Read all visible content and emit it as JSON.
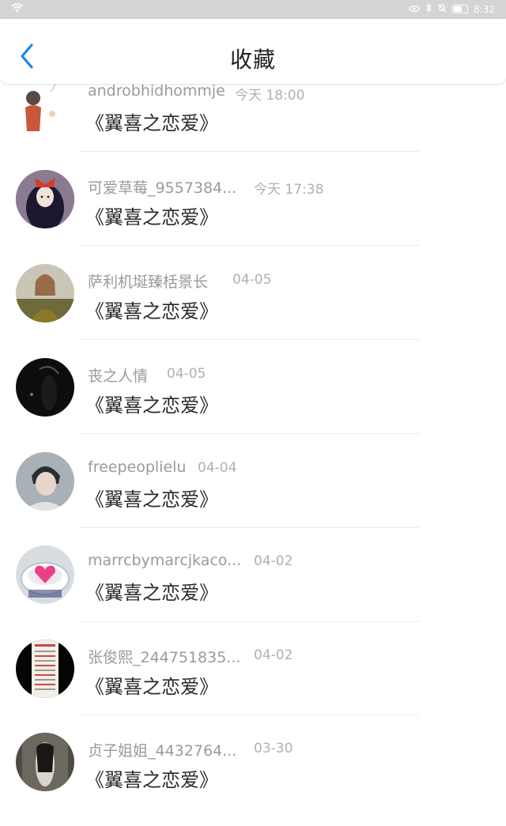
{
  "status_bar": {
    "time": "8:32"
  },
  "header": {
    "title": "收藏"
  },
  "items": [
    {
      "name": "androbhidhommje",
      "time": "今天 18:00",
      "book": "《翼喜之恋爱》"
    },
    {
      "name": "可爱草莓_9557384...",
      "time": "今天 17:38",
      "book": "《翼喜之恋爱》"
    },
    {
      "name": "萨利机埏臻栝景长",
      "time": "04-05",
      "book": "《翼喜之恋爱》"
    },
    {
      "name": "丧之人情",
      "time": "04-05",
      "book": "《翼喜之恋爱》"
    },
    {
      "name": "freepeoplielu",
      "time": "04-04",
      "book": "《翼喜之恋爱》"
    },
    {
      "name": "marrcbymarcjkaco...",
      "time": "04-02",
      "book": "《翼喜之恋爱》"
    },
    {
      "name": "张俊熙_244751835...",
      "time": "04-02",
      "book": "《翼喜之恋爱》"
    },
    {
      "name": "贞子姐姐_4432764...",
      "time": "03-30",
      "book": "《翼喜之恋爱》"
    }
  ],
  "icons": {
    "back": "chevron-left-icon",
    "wifi": "wifi-icon",
    "eye": "eye-comfort-icon",
    "bluetooth": "bluetooth-icon",
    "mute": "bell-off-icon",
    "battery": "battery-icon"
  },
  "colors": {
    "accent": "#1e88e5",
    "name_text": "#9a9a9a",
    "title_text": "#222222"
  }
}
